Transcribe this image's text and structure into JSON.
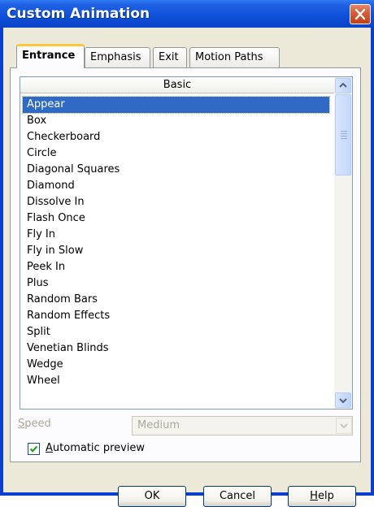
{
  "window": {
    "title": "Custom Animation"
  },
  "tabs": [
    {
      "label": "Entrance",
      "active": true
    },
    {
      "label": "Emphasis",
      "active": false
    },
    {
      "label": "Exit",
      "active": false
    },
    {
      "label": "Motion Paths",
      "active": false
    }
  ],
  "list": {
    "header": "Basic",
    "selected": "Appear",
    "items": [
      "Appear",
      "Box",
      "Checkerboard",
      "Circle",
      "Diagonal Squares",
      "Diamond",
      "Dissolve In",
      "Flash Once",
      "Fly In",
      "Fly in Slow",
      "Peek In",
      "Plus",
      "Random Bars",
      "Random Effects",
      "Split",
      "Venetian Blinds",
      "Wedge",
      "Wheel"
    ]
  },
  "speed": {
    "label_mnemonic": "S",
    "label_rest": "peed",
    "value": "Medium"
  },
  "preview": {
    "mnemonic": "A",
    "rest": "utomatic preview",
    "checked": true
  },
  "buttons": {
    "ok": "OK",
    "cancel": "Cancel",
    "help_mnemonic": "H",
    "help_rest": "elp"
  },
  "colors": {
    "titlebar": "#0a3ecf",
    "selection": "#316ac5",
    "dialog_bg": "#ece9d8",
    "close": "#d55a35"
  }
}
